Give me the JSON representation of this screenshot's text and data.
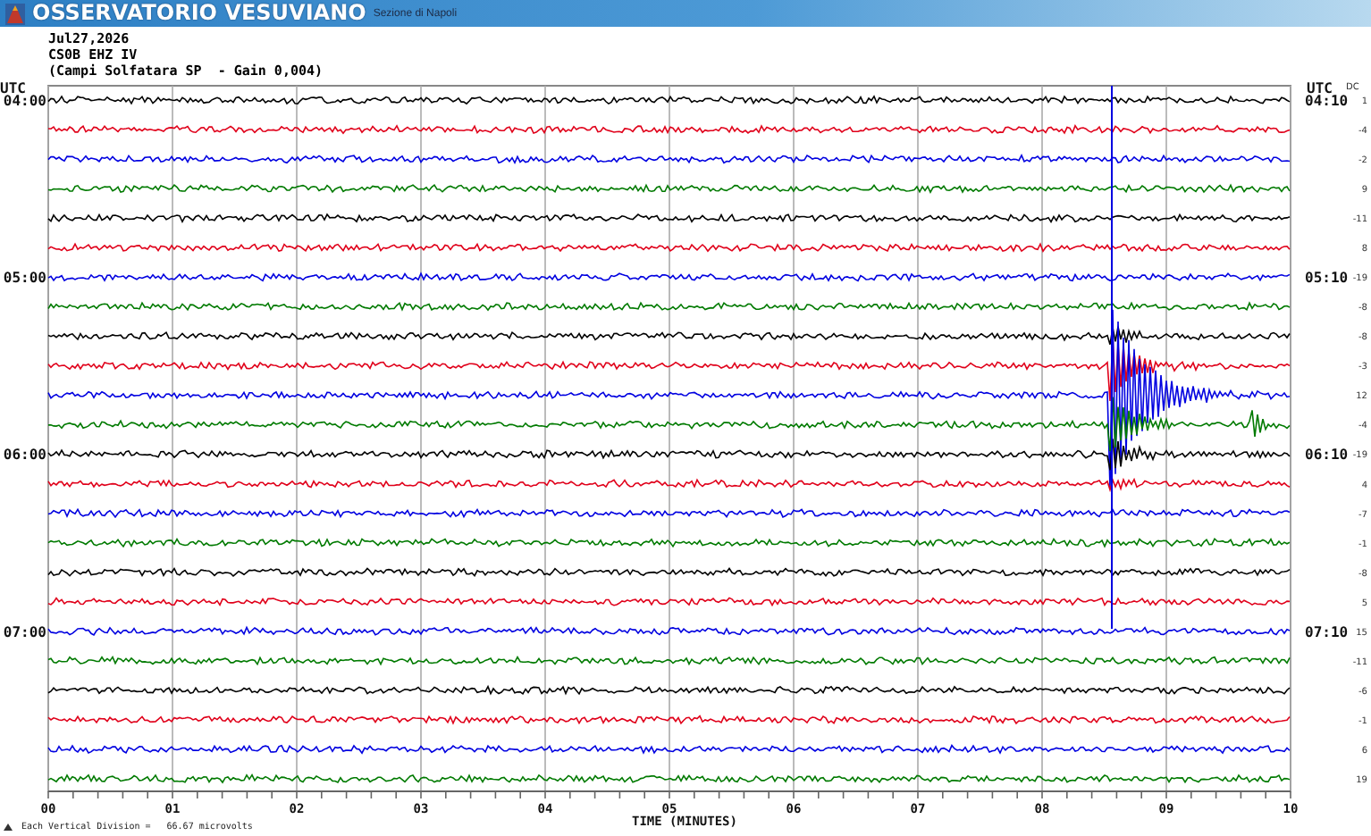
{
  "header": {
    "title": "OSSERVATORIO VESUVIANO",
    "subtitle": "Sezione di Napoli"
  },
  "info": [
    "Jul27,2026",
    "CS0B EHZ IV",
    "(Campi Solfatara SP  - Gain 0,004)"
  ],
  "helicorder": {
    "left_axis_title": "UTC",
    "right_axis_title": "UTC",
    "dc_title": "DC",
    "x_title": "TIME (MINUTES)",
    "x_ticks": [
      "00",
      "01",
      "02",
      "03",
      "04",
      "05",
      "06",
      "07",
      "08",
      "09",
      "10"
    ],
    "traces": [
      {
        "color": "#000000",
        "start_label": "04:00",
        "end_label": "04:10",
        "dc": "1"
      },
      {
        "color": "#e0001a",
        "dc": "-4"
      },
      {
        "color": "#0000e0",
        "dc": "-2"
      },
      {
        "color": "#007a00",
        "dc": "9"
      },
      {
        "color": "#000000",
        "dc": "-11"
      },
      {
        "color": "#e0001a",
        "dc": "8"
      },
      {
        "color": "#0000e0",
        "start_label": "05:00",
        "end_label": "05:10",
        "dc": "-19"
      },
      {
        "color": "#007a00",
        "dc": "-8"
      },
      {
        "color": "#000000",
        "dc": "-8"
      },
      {
        "color": "#e0001a",
        "dc": "-3"
      },
      {
        "color": "#0000e0",
        "dc": "12"
      },
      {
        "color": "#007a00",
        "dc": "-4"
      },
      {
        "color": "#000000",
        "start_label": "06:00",
        "end_label": "06:10",
        "dc": "-19"
      },
      {
        "color": "#e0001a",
        "dc": "4"
      },
      {
        "color": "#0000e0",
        "dc": "-7"
      },
      {
        "color": "#007a00",
        "dc": "-1"
      },
      {
        "color": "#000000",
        "dc": "-8"
      },
      {
        "color": "#e0001a",
        "dc": "5"
      },
      {
        "color": "#0000e0",
        "start_label": "07:00",
        "end_label": "07:10",
        "dc": "15"
      },
      {
        "color": "#007a00",
        "dc": "-11"
      },
      {
        "color": "#000000",
        "dc": "-6"
      },
      {
        "color": "#e0001a",
        "dc": "-1"
      },
      {
        "color": "#0000e0",
        "dc": "6"
      },
      {
        "color": "#007a00",
        "dc": "19"
      }
    ]
  },
  "footer": {
    "scale_note": "Each Vertical Division =   66.67 microvolts"
  }
}
